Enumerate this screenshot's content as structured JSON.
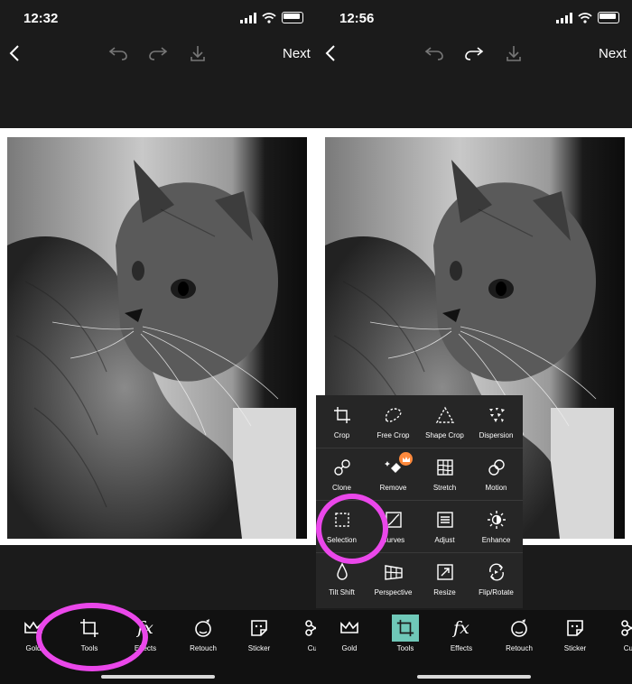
{
  "left": {
    "time": "12:32",
    "next_label": "Next",
    "tabs": [
      {
        "label": "Gold",
        "icon": "crown-icon"
      },
      {
        "label": "Tools",
        "icon": "crop-icon"
      },
      {
        "label": "Effects",
        "icon": "fx-icon"
      },
      {
        "label": "Retouch",
        "icon": "retouch-icon"
      },
      {
        "label": "Sticker",
        "icon": "sticker-icon"
      },
      {
        "label": "Cut",
        "icon": "cutout-icon"
      }
    ]
  },
  "right": {
    "time": "12:56",
    "next_label": "Next",
    "tabs": [
      {
        "label": "Gold",
        "icon": "crown-icon"
      },
      {
        "label": "Tools",
        "icon": "crop-icon"
      },
      {
        "label": "Effects",
        "icon": "fx-icon"
      },
      {
        "label": "Retouch",
        "icon": "retouch-icon"
      },
      {
        "label": "Sticker",
        "icon": "sticker-icon"
      },
      {
        "label": "Cut",
        "icon": "cutout-icon"
      }
    ],
    "tools_menu": [
      [
        {
          "label": "Crop"
        },
        {
          "label": "Free Crop"
        },
        {
          "label": "Shape Crop"
        },
        {
          "label": "Dispersion"
        }
      ],
      [
        {
          "label": "Clone"
        },
        {
          "label": "Remove"
        },
        {
          "label": "Stretch"
        },
        {
          "label": "Motion"
        }
      ],
      [
        {
          "label": "Selection"
        },
        {
          "label": "Curves"
        },
        {
          "label": "Adjust"
        },
        {
          "label": "Enhance"
        }
      ],
      [
        {
          "label": "Tilt Shift"
        },
        {
          "label": "Perspective"
        },
        {
          "label": "Resize"
        },
        {
          "label": "Flip/Rotate"
        }
      ]
    ]
  },
  "colors": {
    "highlight_ring": "#ea47ea",
    "active_tab": "#6fc8b8",
    "premium_badge": "#ff8a3d"
  }
}
